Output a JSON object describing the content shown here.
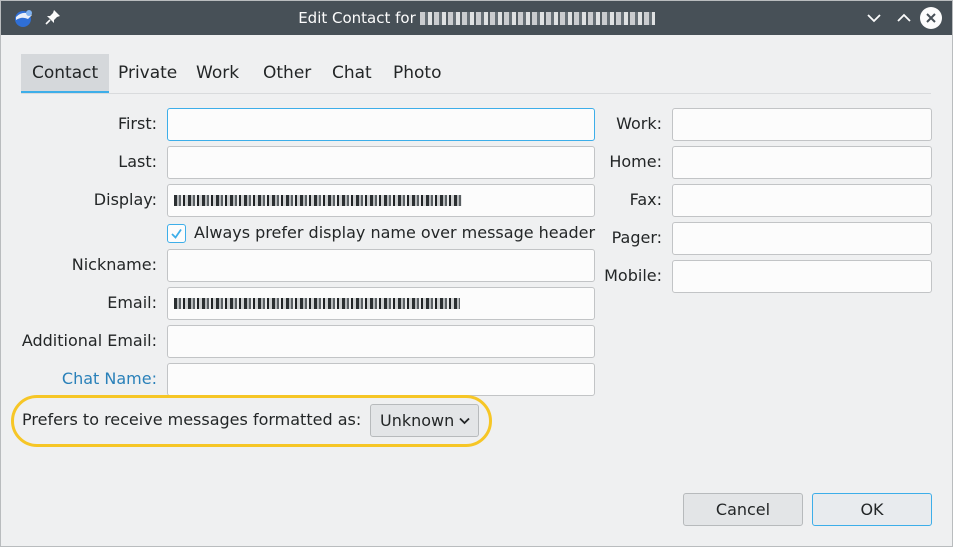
{
  "window": {
    "title_prefix": "Edit Contact for",
    "title_name_redacted": "",
    "colors": {
      "titlebar": "#475057",
      "accent": "#3daee9",
      "highlight": "#f6c626",
      "link": "#2980b9"
    }
  },
  "tabs": [
    {
      "label": "Contact",
      "active": true
    },
    {
      "label": "Private"
    },
    {
      "label": "Work"
    },
    {
      "label": "Other"
    },
    {
      "label": "Chat"
    },
    {
      "label": "Photo"
    }
  ],
  "form": {
    "first": {
      "label": "First:",
      "value": ""
    },
    "last": {
      "label": "Last:",
      "value": ""
    },
    "display": {
      "label": "Display:",
      "value_redacted": true
    },
    "always_prefer": {
      "label": "Always prefer display name over message header",
      "checked": true
    },
    "nickname": {
      "label": "Nickname:",
      "value": ""
    },
    "email": {
      "label": "Email:",
      "value_redacted": true
    },
    "additional_email": {
      "label": "Additional Email:",
      "value": ""
    },
    "chat_name": {
      "label": "Chat Name:",
      "value": ""
    },
    "phones": {
      "work": {
        "label": "Work:",
        "value": ""
      },
      "home": {
        "label": "Home:",
        "value": ""
      },
      "fax": {
        "label": "Fax:",
        "value": ""
      },
      "pager": {
        "label": "Pager:",
        "value": ""
      },
      "mobile": {
        "label": "Mobile:",
        "value": ""
      }
    },
    "prefers_format": {
      "label": "Prefers to receive messages formatted as:",
      "selected": "Unknown"
    }
  },
  "buttons": {
    "cancel": "Cancel",
    "ok": "OK"
  },
  "icons": [
    "thunderbird-app-icon",
    "pin-icon",
    "minimize-icon",
    "maximize-icon",
    "close-icon",
    "checkmark-icon",
    "chevron-down-icon"
  ]
}
